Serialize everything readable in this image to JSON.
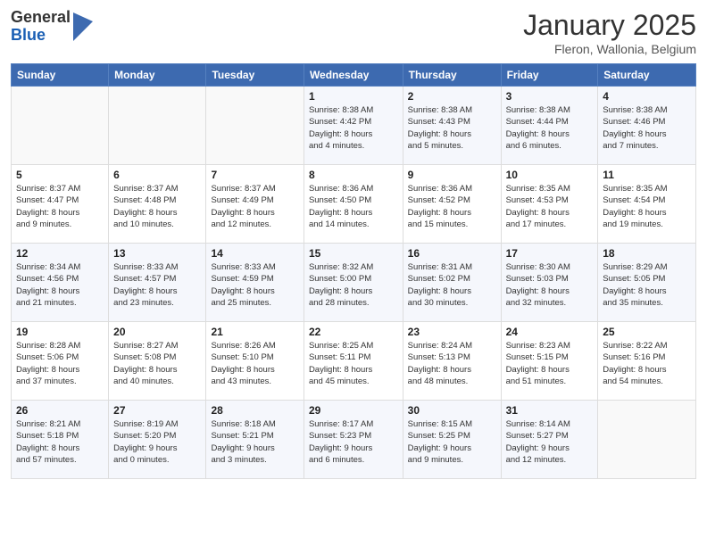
{
  "header": {
    "logo": {
      "general": "General",
      "blue": "Blue"
    },
    "title": "January 2025",
    "location": "Fleron, Wallonia, Belgium"
  },
  "days_of_week": [
    "Sunday",
    "Monday",
    "Tuesday",
    "Wednesday",
    "Thursday",
    "Friday",
    "Saturday"
  ],
  "weeks": [
    {
      "days": [
        {
          "num": "",
          "info": ""
        },
        {
          "num": "",
          "info": ""
        },
        {
          "num": "",
          "info": ""
        },
        {
          "num": "1",
          "info": "Sunrise: 8:38 AM\nSunset: 4:42 PM\nDaylight: 8 hours\nand 4 minutes."
        },
        {
          "num": "2",
          "info": "Sunrise: 8:38 AM\nSunset: 4:43 PM\nDaylight: 8 hours\nand 5 minutes."
        },
        {
          "num": "3",
          "info": "Sunrise: 8:38 AM\nSunset: 4:44 PM\nDaylight: 8 hours\nand 6 minutes."
        },
        {
          "num": "4",
          "info": "Sunrise: 8:38 AM\nSunset: 4:46 PM\nDaylight: 8 hours\nand 7 minutes."
        }
      ]
    },
    {
      "days": [
        {
          "num": "5",
          "info": "Sunrise: 8:37 AM\nSunset: 4:47 PM\nDaylight: 8 hours\nand 9 minutes."
        },
        {
          "num": "6",
          "info": "Sunrise: 8:37 AM\nSunset: 4:48 PM\nDaylight: 8 hours\nand 10 minutes."
        },
        {
          "num": "7",
          "info": "Sunrise: 8:37 AM\nSunset: 4:49 PM\nDaylight: 8 hours\nand 12 minutes."
        },
        {
          "num": "8",
          "info": "Sunrise: 8:36 AM\nSunset: 4:50 PM\nDaylight: 8 hours\nand 14 minutes."
        },
        {
          "num": "9",
          "info": "Sunrise: 8:36 AM\nSunset: 4:52 PM\nDaylight: 8 hours\nand 15 minutes."
        },
        {
          "num": "10",
          "info": "Sunrise: 8:35 AM\nSunset: 4:53 PM\nDaylight: 8 hours\nand 17 minutes."
        },
        {
          "num": "11",
          "info": "Sunrise: 8:35 AM\nSunset: 4:54 PM\nDaylight: 8 hours\nand 19 minutes."
        }
      ]
    },
    {
      "days": [
        {
          "num": "12",
          "info": "Sunrise: 8:34 AM\nSunset: 4:56 PM\nDaylight: 8 hours\nand 21 minutes."
        },
        {
          "num": "13",
          "info": "Sunrise: 8:33 AM\nSunset: 4:57 PM\nDaylight: 8 hours\nand 23 minutes."
        },
        {
          "num": "14",
          "info": "Sunrise: 8:33 AM\nSunset: 4:59 PM\nDaylight: 8 hours\nand 25 minutes."
        },
        {
          "num": "15",
          "info": "Sunrise: 8:32 AM\nSunset: 5:00 PM\nDaylight: 8 hours\nand 28 minutes."
        },
        {
          "num": "16",
          "info": "Sunrise: 8:31 AM\nSunset: 5:02 PM\nDaylight: 8 hours\nand 30 minutes."
        },
        {
          "num": "17",
          "info": "Sunrise: 8:30 AM\nSunset: 5:03 PM\nDaylight: 8 hours\nand 32 minutes."
        },
        {
          "num": "18",
          "info": "Sunrise: 8:29 AM\nSunset: 5:05 PM\nDaylight: 8 hours\nand 35 minutes."
        }
      ]
    },
    {
      "days": [
        {
          "num": "19",
          "info": "Sunrise: 8:28 AM\nSunset: 5:06 PM\nDaylight: 8 hours\nand 37 minutes."
        },
        {
          "num": "20",
          "info": "Sunrise: 8:27 AM\nSunset: 5:08 PM\nDaylight: 8 hours\nand 40 minutes."
        },
        {
          "num": "21",
          "info": "Sunrise: 8:26 AM\nSunset: 5:10 PM\nDaylight: 8 hours\nand 43 minutes."
        },
        {
          "num": "22",
          "info": "Sunrise: 8:25 AM\nSunset: 5:11 PM\nDaylight: 8 hours\nand 45 minutes."
        },
        {
          "num": "23",
          "info": "Sunrise: 8:24 AM\nSunset: 5:13 PM\nDaylight: 8 hours\nand 48 minutes."
        },
        {
          "num": "24",
          "info": "Sunrise: 8:23 AM\nSunset: 5:15 PM\nDaylight: 8 hours\nand 51 minutes."
        },
        {
          "num": "25",
          "info": "Sunrise: 8:22 AM\nSunset: 5:16 PM\nDaylight: 8 hours\nand 54 minutes."
        }
      ]
    },
    {
      "days": [
        {
          "num": "26",
          "info": "Sunrise: 8:21 AM\nSunset: 5:18 PM\nDaylight: 8 hours\nand 57 minutes."
        },
        {
          "num": "27",
          "info": "Sunrise: 8:19 AM\nSunset: 5:20 PM\nDaylight: 9 hours\nand 0 minutes."
        },
        {
          "num": "28",
          "info": "Sunrise: 8:18 AM\nSunset: 5:21 PM\nDaylight: 9 hours\nand 3 minutes."
        },
        {
          "num": "29",
          "info": "Sunrise: 8:17 AM\nSunset: 5:23 PM\nDaylight: 9 hours\nand 6 minutes."
        },
        {
          "num": "30",
          "info": "Sunrise: 8:15 AM\nSunset: 5:25 PM\nDaylight: 9 hours\nand 9 minutes."
        },
        {
          "num": "31",
          "info": "Sunrise: 8:14 AM\nSunset: 5:27 PM\nDaylight: 9 hours\nand 12 minutes."
        },
        {
          "num": "",
          "info": ""
        }
      ]
    }
  ]
}
